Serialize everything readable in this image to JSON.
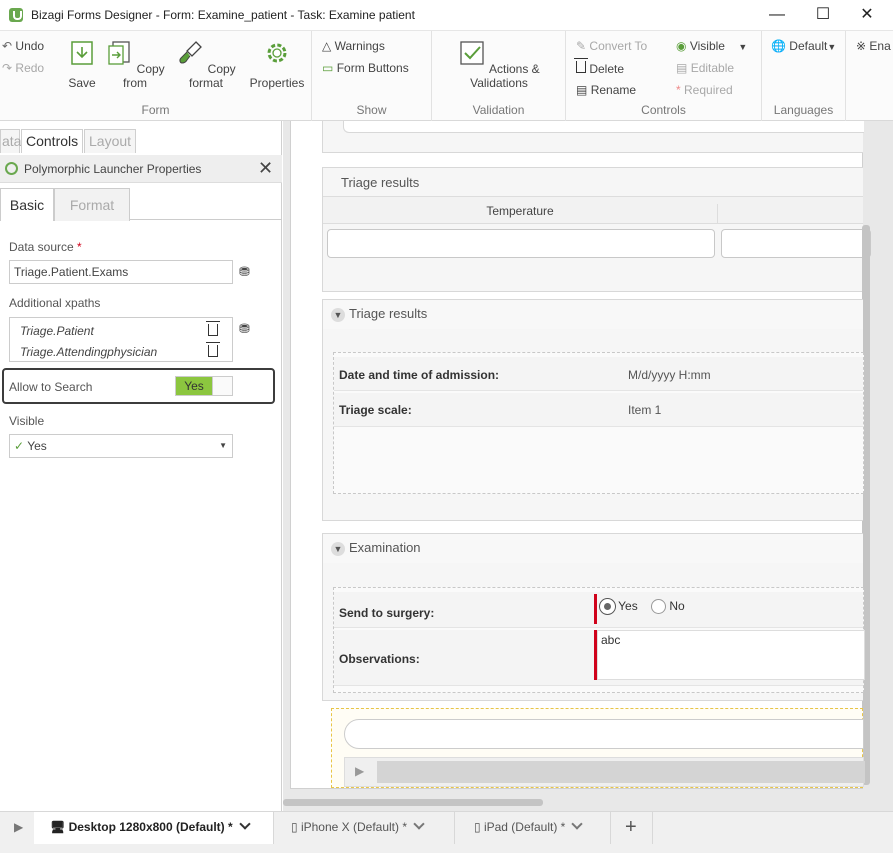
{
  "window": {
    "title": "Bizagi Forms Designer  - Form: Examine_patient - Task:  Examine patient"
  },
  "ribbon": {
    "undo": "Undo",
    "redo": "Redo",
    "save": "Save",
    "copy_from": "Copy from",
    "copy_format": "Copy format",
    "properties": "Properties",
    "group_form": "Form",
    "warnings": "Warnings",
    "form_buttons": "Form Buttons",
    "group_show": "Show",
    "actions_validations": "Actions & Validations",
    "group_validation": "Validation",
    "convert_to": "Convert To",
    "delete": "Delete",
    "rename": "Rename",
    "visible": "Visible",
    "editable": "Editable",
    "required": "Required",
    "group_controls": "Controls",
    "language_default": "Default",
    "group_languages": "Languages",
    "enable_partial": "Ena"
  },
  "left_tabs": [
    "ata",
    "Controls",
    "Layout"
  ],
  "props": {
    "title": "Polymorphic Launcher Properties",
    "tab_basic": "Basic",
    "tab_format": "Format",
    "data_source_label": "Data source",
    "required_mark": "*",
    "data_source_value": "Triage.Patient.Exams",
    "additional_xpaths_label": "Additional xpaths",
    "xpaths": [
      "Triage.Patient",
      "Triage.Attendingphysician"
    ],
    "allow_search_label": "Allow to Search",
    "allow_search_value": "Yes",
    "visible_label": "Visible",
    "visible_value": "Yes"
  },
  "form": {
    "grid_title": "Triage results",
    "grid_col1": "Temperature",
    "group1_title": "Triage results",
    "admission_label": "Date and time of admission:",
    "admission_value": "M/d/yyyy H:mm",
    "triage_scale_label": "Triage scale:",
    "triage_scale_value": "Item 1",
    "group2_title": "Examination",
    "surgery_label": "Send to surgery:",
    "surgery_yes": "Yes",
    "surgery_no": "No",
    "observations_label": "Observations:",
    "observations_value": "abc"
  },
  "bottom_tabs": [
    {
      "label": "Desktop 1280x800 (Default)",
      "star": "*"
    },
    {
      "label": "iPhone X (Default)",
      "star": "*"
    },
    {
      "label": "iPad (Default)",
      "star": "*"
    }
  ],
  "add_tab": "+",
  "colors": {
    "accent_green": "#8cc63f",
    "required_red": "#d0021b"
  }
}
